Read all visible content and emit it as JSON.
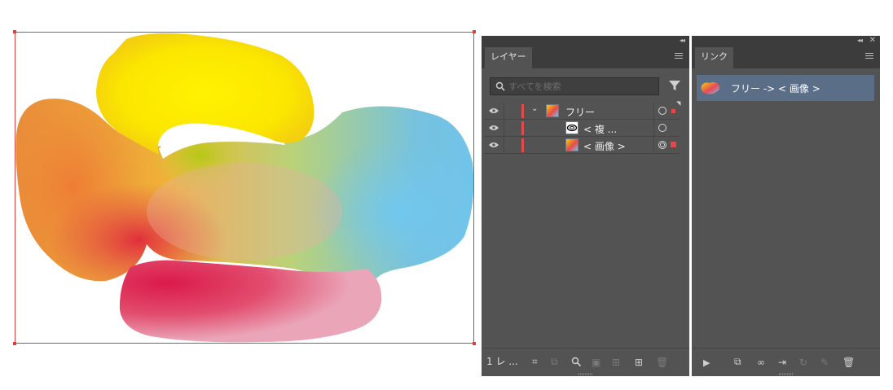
{
  "canvas": {
    "selection_color": "#d94040"
  },
  "layers_panel": {
    "tab_label": "レイヤー",
    "search_placeholder": "すべてを検索",
    "filter_icon": "filter-funnel-icon",
    "rows": [
      {
        "name": "フリー",
        "kind": "group",
        "expanded": true,
        "thumb": "gradient"
      },
      {
        "name": "< 複 ...",
        "kind": "compound-path",
        "thumb": "path"
      },
      {
        "name": "< 画像 >",
        "kind": "image",
        "thumb": "gradient"
      }
    ],
    "status": "1 レ ...",
    "bottom_icons": [
      "collect-for-export-icon",
      "export-icon",
      "locate-object-icon",
      "make-clipping-mask-icon",
      "create-sublayer-icon",
      "new-layer-icon",
      "delete-icon"
    ]
  },
  "links_panel": {
    "tab_label": "リンク",
    "items": [
      {
        "name": "フリー -> < 画像 >"
      }
    ],
    "bottom_icons": [
      "show-info-icon",
      "relink-from-cc-icon",
      "relink-icon",
      "go-to-link-icon",
      "update-link-icon",
      "edit-original-icon",
      "delete-icon"
    ]
  },
  "colors": {
    "panel_bg": "#535353",
    "panel_dark": "#3c3c3c",
    "selection_row": "#5a6e88",
    "layer_color": "#e04a4a"
  }
}
